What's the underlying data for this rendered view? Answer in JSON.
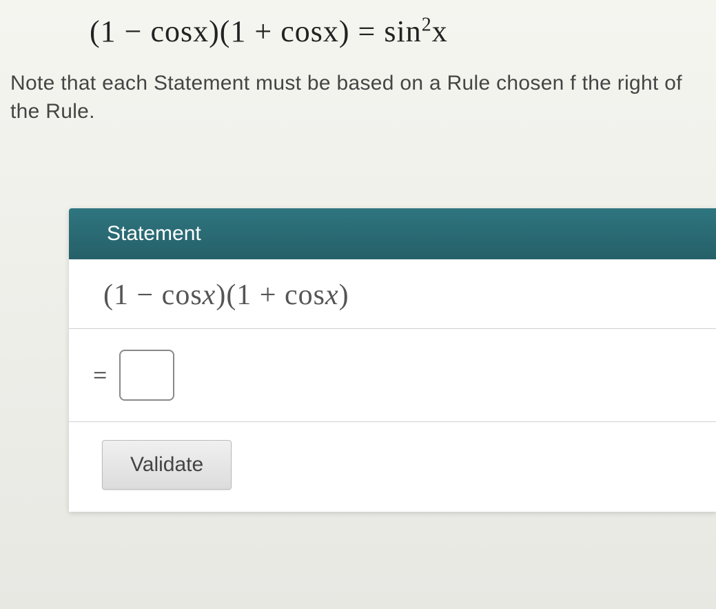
{
  "equation": {
    "lhs_part1": "(1 − cos",
    "lhs_var1": "x",
    "lhs_part2": ")(1 + cos",
    "lhs_var2": "x",
    "lhs_part3": ") = sin",
    "exponent": "2",
    "rhs_var": "x"
  },
  "note_text": "Note that each Statement must be based on a Rule chosen f the right of the Rule.",
  "panel": {
    "header": "Statement",
    "expression": {
      "part1": "(1 − cos",
      "var1": "x",
      "part2": ")(1 + cos",
      "var2": "x",
      "part3": ")"
    },
    "equals_label": "=",
    "answer_value": "",
    "validate_label": "Validate"
  }
}
